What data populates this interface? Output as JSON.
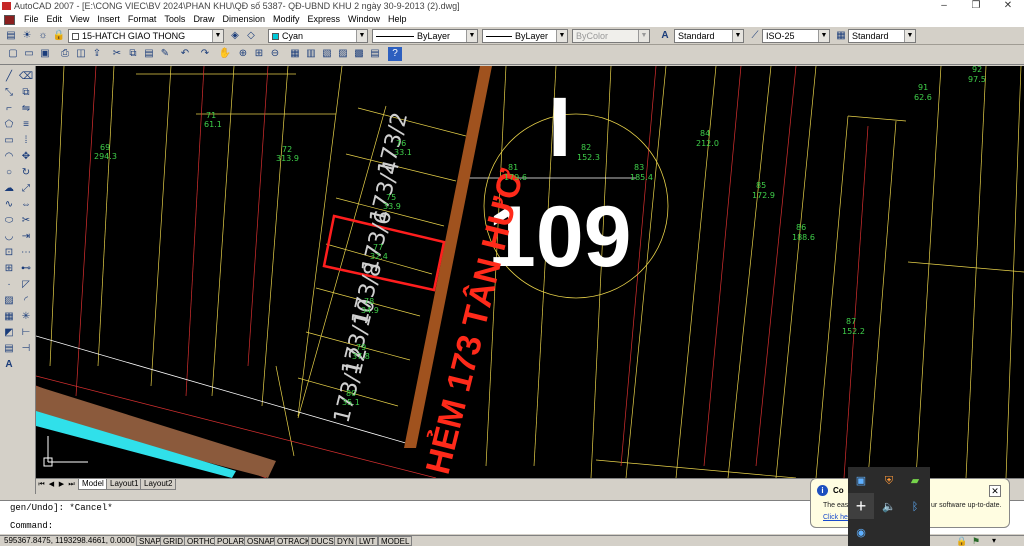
{
  "window": {
    "title": "AutoCAD 2007 - [E:\\CONG  VIEC\\BV 2024\\PHAN KHU\\QĐ số 5387- QĐ-UBND KHU 2 ngày 30-9-2013 (2).dwg]",
    "minimize": "–",
    "maximize": "❐",
    "close": "✕"
  },
  "menu": [
    "File",
    "Edit",
    "View",
    "Insert",
    "Format",
    "Tools",
    "Draw",
    "Dimension",
    "Modify",
    "Express",
    "Window",
    "Help"
  ],
  "toolbar": {
    "layer_value": "15-HATCH GIAO THONG",
    "color_value": "Cyan",
    "linetype_value": "ByLayer",
    "lineweight_value": "ByLayer",
    "plotstyle_value": "ByColor",
    "textstyle_value": "Standard",
    "dimstyle_value": "ISO-25",
    "tablestyle_value": "Standard",
    "accent_cyan": "#00c8d8"
  },
  "drawing": {
    "street_label": "HẺM 173 TÂN HƯƠ",
    "block_letter": "I",
    "block_number": "109",
    "lots": [
      {
        "id": "173/2",
        "stn": "76",
        "area": "33.1"
      },
      {
        "id": "173/4",
        "stn": "75",
        "area": "33.9"
      },
      {
        "id": "173/6",
        "stn": "77",
        "area": "32.4"
      },
      {
        "id": "173/8",
        "stn": "78",
        "area": "34.9"
      },
      {
        "id": "173/10",
        "stn": "79",
        "area": "37.8"
      },
      {
        "id": "173/12",
        "stn": "80",
        "area": "35.1"
      }
    ],
    "parcels": [
      {
        "stn": "69",
        "area": "294.3"
      },
      {
        "stn": "71",
        "area": "61.1"
      },
      {
        "stn": "72",
        "area": "313.9"
      },
      {
        "stn": "81",
        "area": "179.6"
      },
      {
        "stn": "82",
        "area": "152.3"
      },
      {
        "stn": "83",
        "area": "185.4"
      },
      {
        "stn": "84",
        "area": "212.0"
      },
      {
        "stn": "85",
        "area": "172.9"
      },
      {
        "stn": "86",
        "area": "188.6"
      },
      {
        "stn": "87",
        "area": "152.2"
      },
      {
        "stn": "91",
        "area": "62.6"
      },
      {
        "stn": "92",
        "area": "97.5"
      }
    ]
  },
  "layout_tabs": [
    "Model",
    "Layout1",
    "Layout2"
  ],
  "command": {
    "line1": "gen/Undo]: *Cancel*",
    "line2": "Command:"
  },
  "status": {
    "coords": "595367.8475, 1193298.4661, 0.0000",
    "buttons": [
      "SNAP",
      "GRID",
      "ORTHO",
      "POLAR",
      "OSNAP",
      "OTRACK",
      "DUCS",
      "DYN",
      "LWT",
      "MODEL"
    ]
  },
  "notification": {
    "title": "Co",
    "body_start": "The easy",
    "body_end": "ur software up-to-date.",
    "link": "Click her",
    "close": "✕"
  }
}
